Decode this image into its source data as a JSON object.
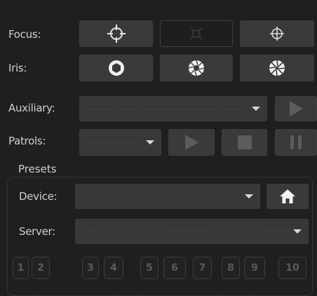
{
  "focus": {
    "label": "Focus:",
    "buttons": [
      "focus-near-icon",
      "focus-auto-icon",
      "focus-far-icon"
    ]
  },
  "iris": {
    "label": "Iris:",
    "buttons": [
      "iris-open-icon",
      "iris-auto-icon",
      "iris-close-icon"
    ]
  },
  "auxiliary": {
    "label": "Auxiliary:",
    "value": ""
  },
  "patrols": {
    "label": "Patrols:",
    "value": ""
  },
  "presets": {
    "title": "Presets",
    "device_label": "Device:",
    "device_value": "",
    "server_label": "Server:",
    "server_value": "",
    "numbers": [
      "1",
      "2",
      "3",
      "4",
      "5",
      "6",
      "7",
      "8",
      "9",
      "10"
    ]
  },
  "colors": {
    "background": "#1f1f1f",
    "button": "#3a3a3a",
    "icon": "#e8e8e8"
  }
}
